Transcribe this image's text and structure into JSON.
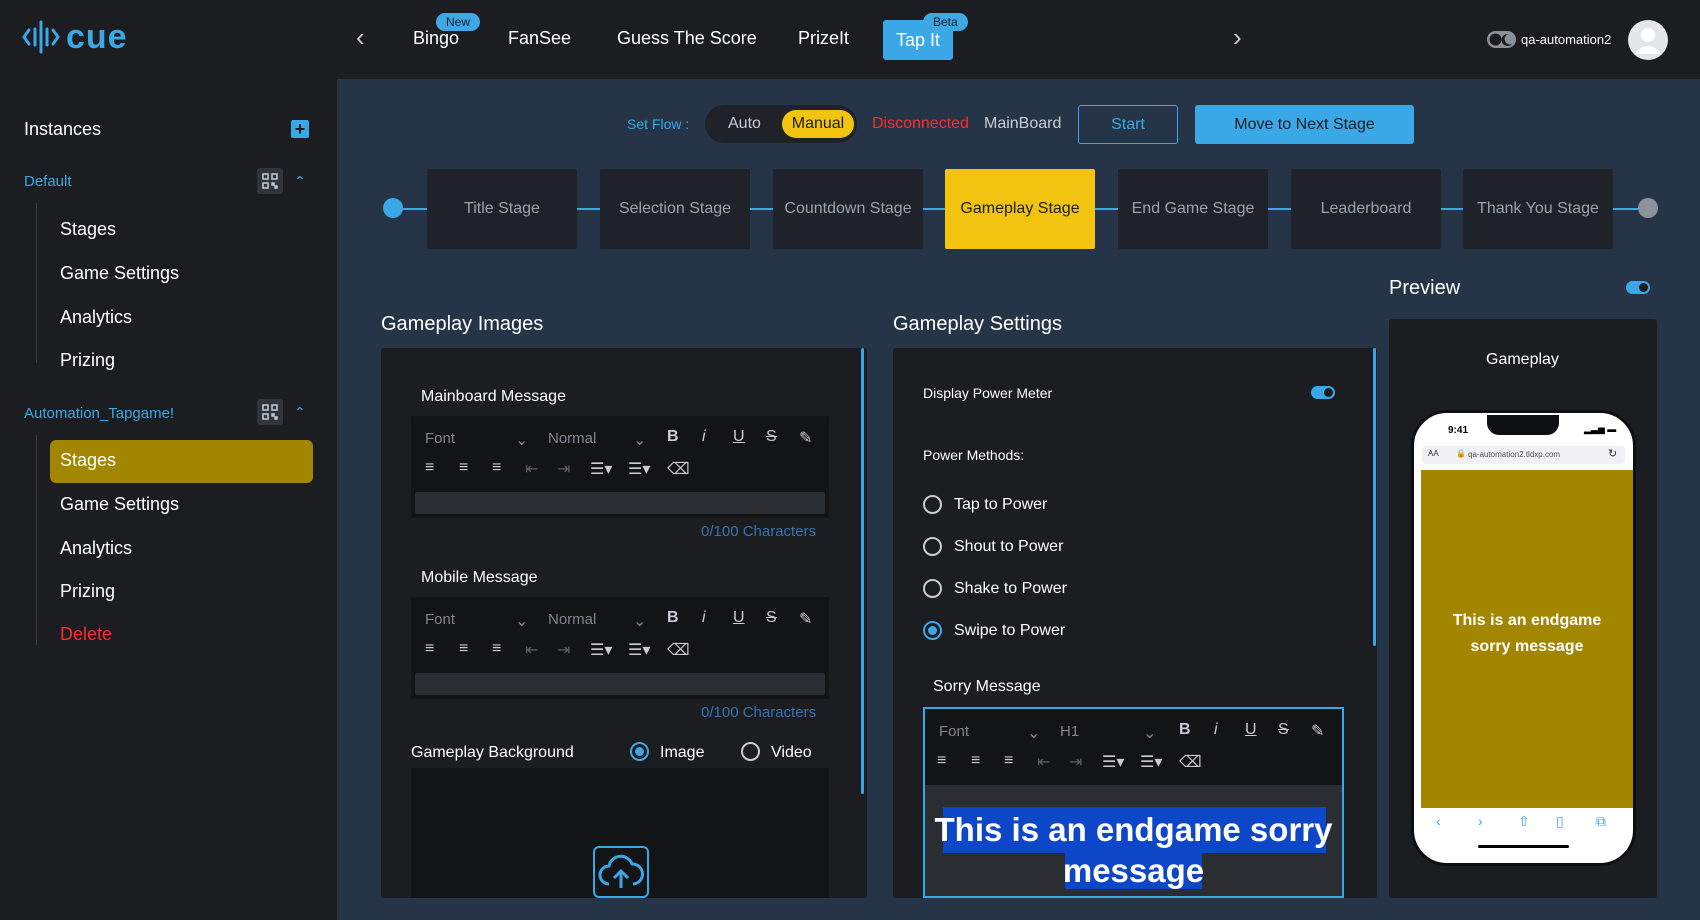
{
  "app": {
    "brand": "cue",
    "brand_color": "#3aa8e6",
    "user": "qa-automation2"
  },
  "topnav": {
    "items": [
      {
        "label": "Bingo",
        "badge": "New"
      },
      {
        "label": "FanSee"
      },
      {
        "label": "Guess The Score"
      },
      {
        "label": "PrizeIt"
      },
      {
        "label": "Tap It",
        "badge": "Beta",
        "active": true
      }
    ]
  },
  "sidebar": {
    "title": "Instances",
    "groups": [
      {
        "name": "Default",
        "items": [
          "Stages",
          "Game Settings",
          "Analytics",
          "Prizing"
        ]
      },
      {
        "name": "Automation_Tapgame!",
        "items": [
          "Stages",
          "Game Settings",
          "Analytics",
          "Prizing",
          "Delete"
        ]
      }
    ]
  },
  "flow": {
    "label": "Set Flow :",
    "options": [
      "Auto",
      "Manual"
    ],
    "selected": "Manual",
    "status": "Disconnected",
    "board": "MainBoard",
    "start_label": "Start",
    "next_label": "Move to Next Stage"
  },
  "stages": [
    "Title Stage",
    "Selection Stage",
    "Countdown Stage",
    "Gameplay Stage",
    "End Game Stage",
    "Leaderboard",
    "Thank You Stage"
  ],
  "active_stage": "Gameplay Stage",
  "images": {
    "title": "Gameplay Images",
    "mainboard": {
      "label": "Mainboard Message",
      "chars": "0/100 Characters"
    },
    "mobile": {
      "label": "Mobile Message",
      "chars": "0/100 Characters"
    },
    "toolbar": {
      "font": "Font",
      "size": "Normal"
    },
    "background": {
      "label": "Gameplay Background",
      "options": [
        "Image",
        "Video"
      ],
      "selected": "Image"
    }
  },
  "settings": {
    "title": "Gameplay Settings",
    "power_meter_label": "Display Power Meter",
    "power_meter_on": true,
    "methods_label": "Power Methods:",
    "methods": [
      "Tap to Power",
      "Shout to Power",
      "Shake to Power",
      "Swipe to Power"
    ],
    "selected_method": "Swipe to Power",
    "sorry": {
      "label": "Sorry Message",
      "font": "Font",
      "size": "H1",
      "line1": "This is an endgame sorry",
      "line2": "message"
    }
  },
  "preview": {
    "title": "Preview",
    "enabled": true,
    "screen_title": "Gameplay",
    "time": "9:41",
    "url": "qa-automation2.tldxp.com",
    "aa": "AA",
    "message": "This is an endgame sorry message"
  }
}
